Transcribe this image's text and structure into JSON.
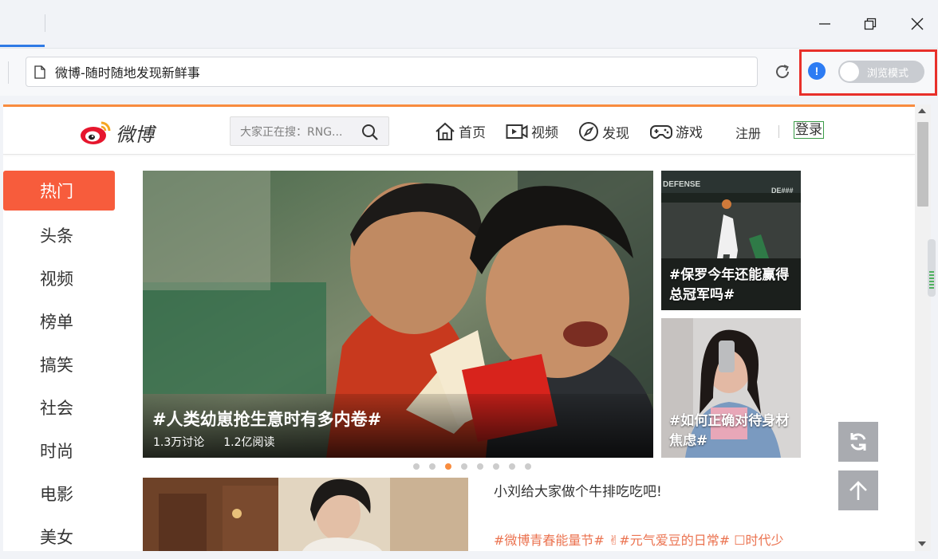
{
  "browser": {
    "address_bar": {
      "title": "微博-随时随地发现新鲜事"
    },
    "browse_mode_toggle": {
      "label": "浏览模式",
      "state": "off"
    },
    "info_badge": "!",
    "highlight_color": "#e8302a",
    "tab_accent": "#2f7ae5"
  },
  "weibo": {
    "header": {
      "logo_text": "微博",
      "search_placeholder": "大家正在搜：RNG...",
      "nav": [
        {
          "label": "首页",
          "icon": "home-icon"
        },
        {
          "label": "视频",
          "icon": "video-icon"
        },
        {
          "label": "发现",
          "icon": "compass-icon"
        },
        {
          "label": "游戏",
          "icon": "gamepad-icon"
        }
      ],
      "register": "注册",
      "login": "登录"
    },
    "sidebar": {
      "items": [
        "热门",
        "头条",
        "视频",
        "榜单",
        "搞笑",
        "社会",
        "时尚",
        "电影",
        "美女"
      ],
      "active_index": 0
    },
    "hero": {
      "title": "#人类幼崽抢生意时有多内卷#",
      "discussions": "1.3万讨论",
      "reads": "1.2亿阅读"
    },
    "side_cards": [
      {
        "caption": "#保罗今年还能赢得总冠军吗#"
      },
      {
        "caption": "#如何正确对待身材焦虑#"
      }
    ],
    "carousel": {
      "count": 8,
      "active_index": 2
    },
    "post": {
      "text": "小刘给大家做个牛排吃吃吧!",
      "tags": "#微博青春能量节# ✌#元气爱豆的日常# ☐时代少"
    },
    "accent_color": "#f75c3c"
  }
}
